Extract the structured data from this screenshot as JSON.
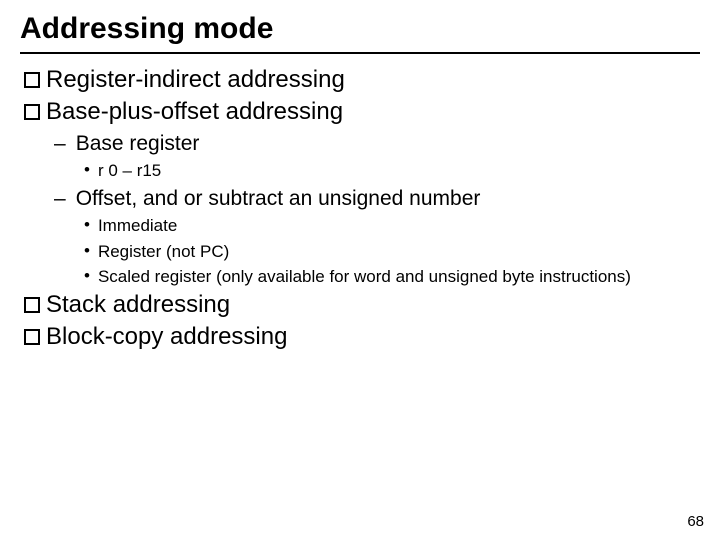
{
  "title": "Addressing mode",
  "items": {
    "l1a": "Register-indirect addressing",
    "l1b": "Base-plus-offset addressing",
    "l2a": "Base register",
    "l3a": "r 0 – r15",
    "l2b": "Offset, and or subtract an unsigned number",
    "l3b": "Immediate",
    "l3c": "Register (not PC)",
    "l3d": "Scaled register (only available for word and unsigned byte instructions)",
    "l1c": "Stack addressing",
    "l1d": "Block-copy addressing"
  },
  "pagenum": "68"
}
